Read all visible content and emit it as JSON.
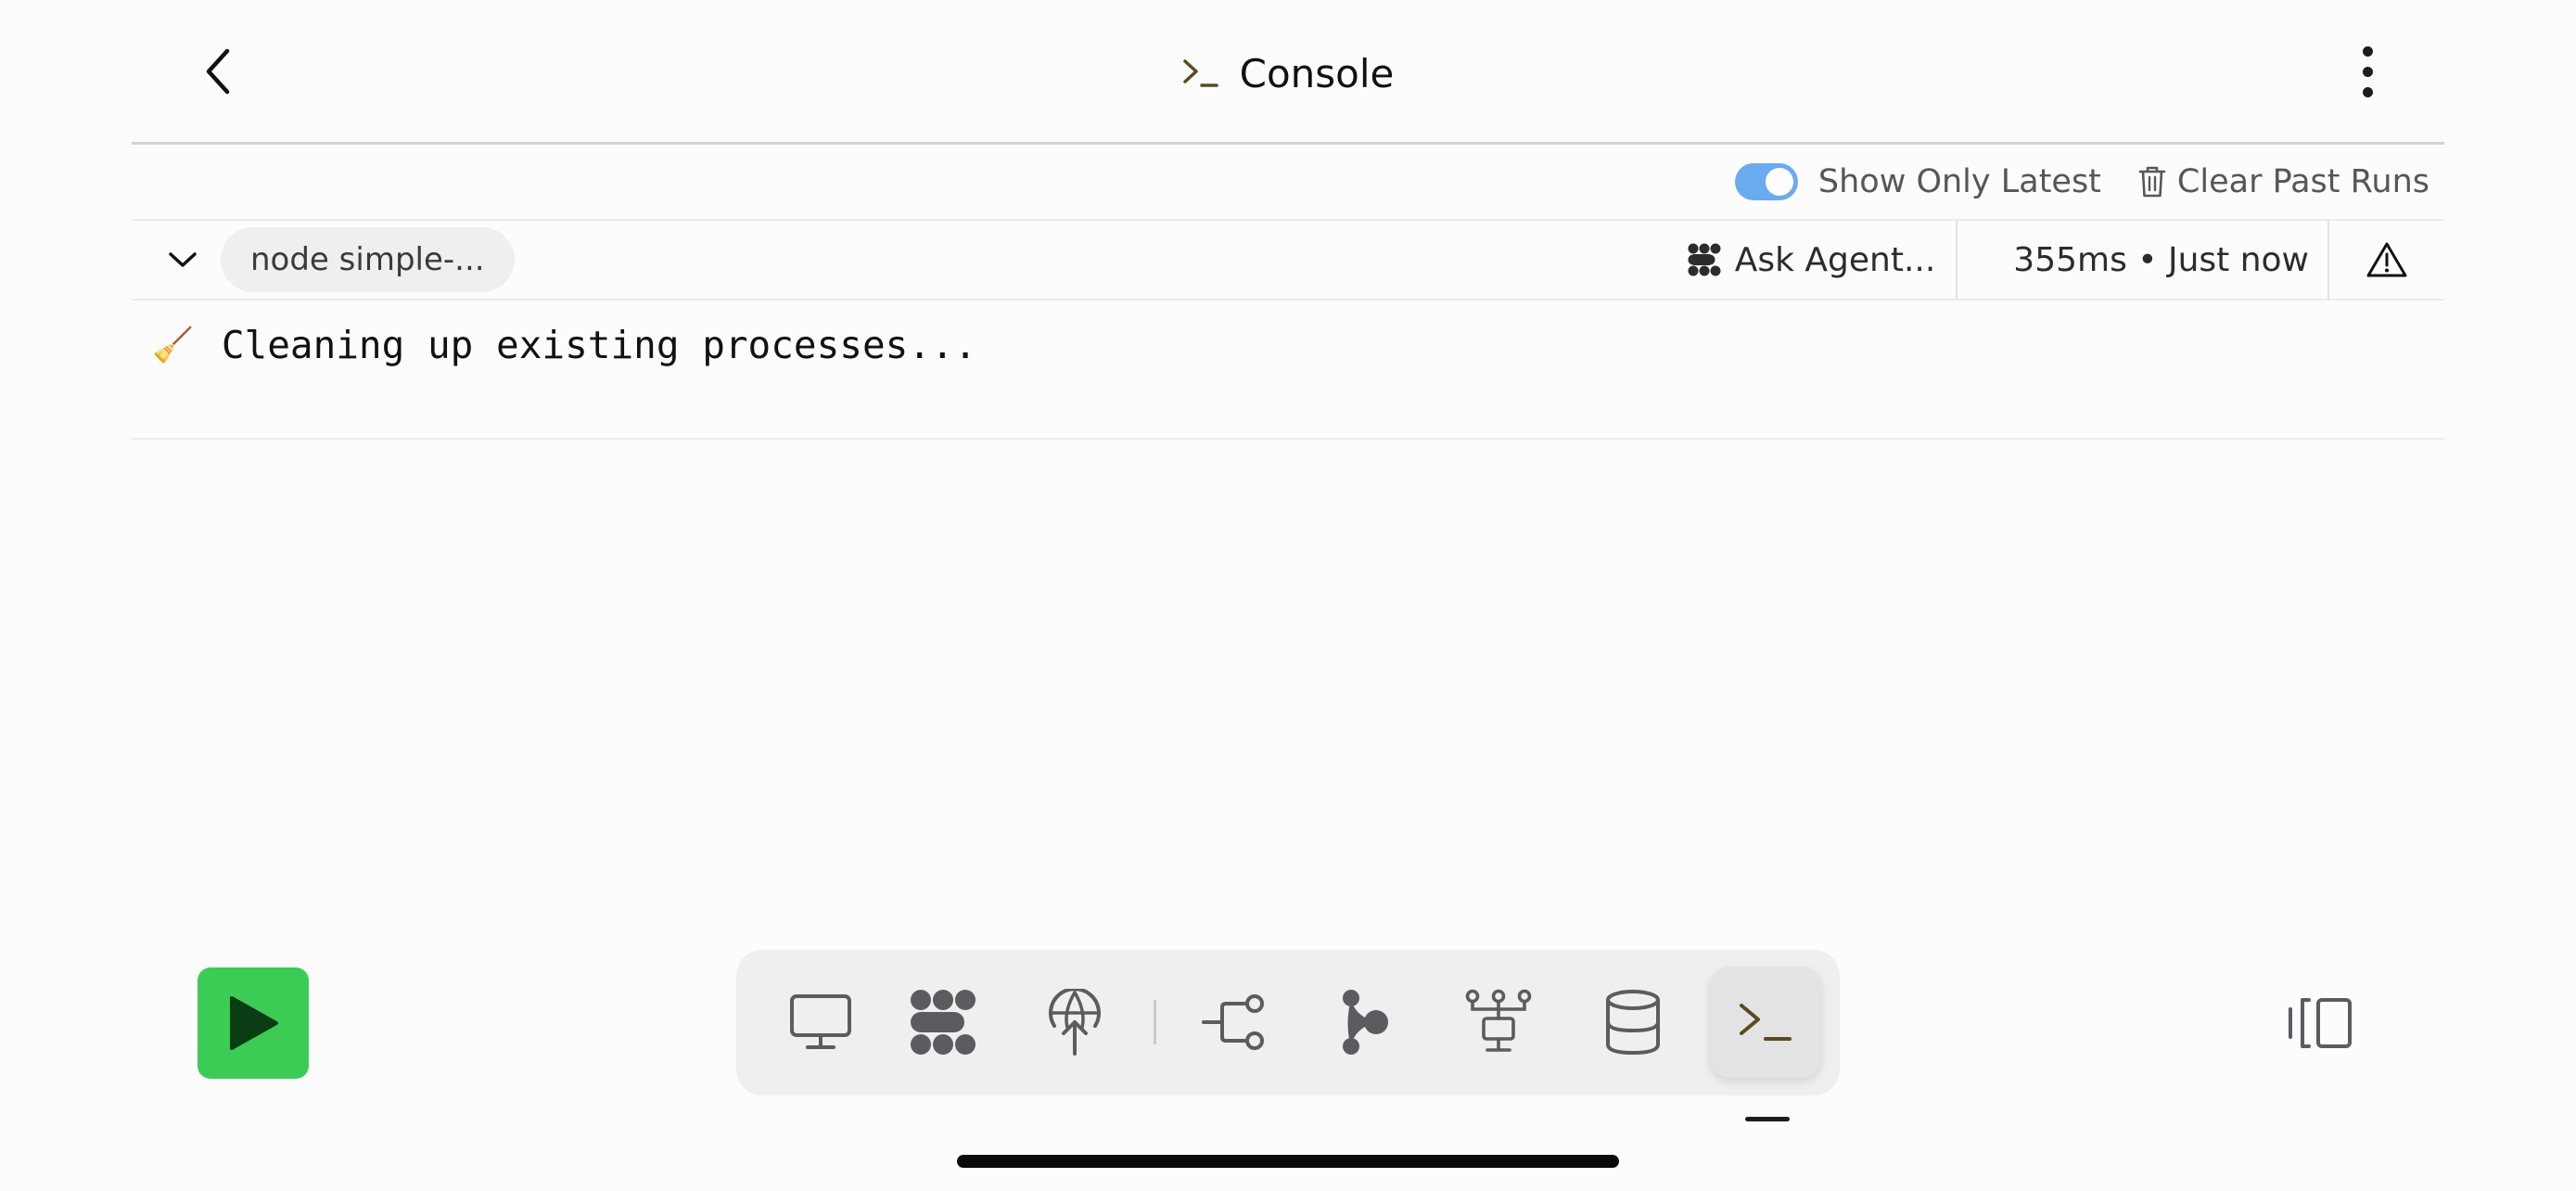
{
  "header": {
    "title": "Console",
    "back_icon": "chevron-left-icon",
    "title_icon": "terminal-icon",
    "more_icon": "more-vertical-icon"
  },
  "controls": {
    "show_only_latest_label": "Show Only Latest",
    "show_only_latest_on": true,
    "clear_past_runs_label": "Clear Past Runs"
  },
  "run": {
    "command": "node simple-...",
    "ask_agent_label": "Ask Agent...",
    "timing": "355ms • Just now"
  },
  "log": {
    "lines": [
      {
        "emoji": "🧹",
        "text": "Cleaning up existing processes..."
      }
    ]
  },
  "dock": {
    "items": [
      {
        "icon": "monitor-icon",
        "active": false
      },
      {
        "icon": "agent-icon",
        "active": false
      },
      {
        "icon": "deploy-globe-icon",
        "active": false
      },
      {
        "icon": "git-branch-icon",
        "active": false
      },
      {
        "icon": "workflow-icon",
        "active": false
      },
      {
        "icon": "network-icon",
        "active": false
      },
      {
        "icon": "database-icon",
        "active": false
      },
      {
        "icon": "terminal-icon",
        "active": true
      }
    ]
  },
  "colors": {
    "accent_toggle": "#6aabf0",
    "run_button": "#3ccc55",
    "run_button_icon": "#0b3d14",
    "terminal_prompt": "#5a4a1e"
  }
}
